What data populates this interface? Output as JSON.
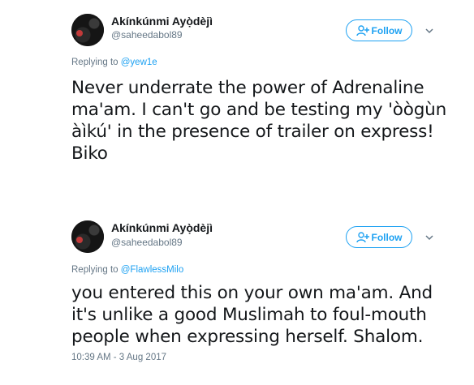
{
  "tweets": [
    {
      "name": "Akínkúnmi Ayọ̀dèjì",
      "handle": "@saheedabol89",
      "follow_label": "Follow",
      "replying_prefix": "Replying to",
      "replying_to": "@yew1e",
      "text": "Never underrate the power of Adrenaline ma'am. I can't go and be testing my 'òògùn àìkú' in the presence of trailer on express! Biko"
    },
    {
      "name": "Akínkúnmi Ayọ̀dèjì",
      "handle": "@saheedabol89",
      "follow_label": "Follow",
      "replying_prefix": "Replying to",
      "replying_to": "@FlawlessMilo",
      "text": "you entered this on your own ma'am. And it's unlike a good Muslimah to foul-mouth people when expressing herself. Shalom.",
      "timestamp": "10:39 AM - 3 Aug 2017"
    }
  ],
  "icons": {
    "follow": "add-user-icon",
    "caret": "chevron-down-icon"
  },
  "colors": {
    "accent": "#1da1f2",
    "text": "#14171a",
    "muted": "#657786"
  }
}
